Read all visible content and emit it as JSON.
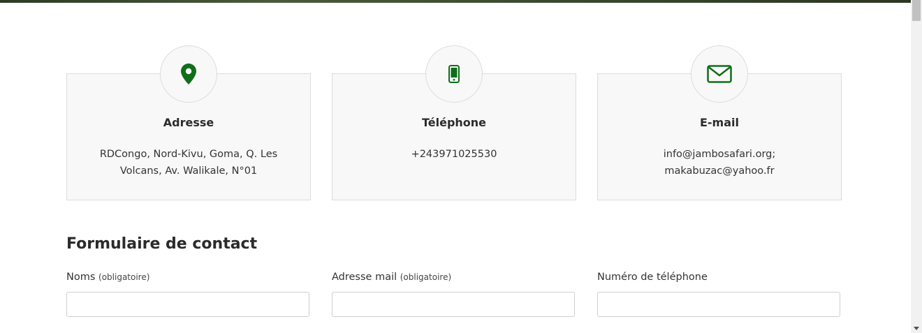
{
  "colors": {
    "accent": "#0f6e1a",
    "card_bg": "#f8f8f8",
    "border": "#dcdcdc"
  },
  "cards": [
    {
      "icon": "map-pin-icon",
      "title": "Adresse",
      "lines": [
        "RDCongo, Nord-Kivu, Goma, Q. Les",
        "Volcans, Av. Walikale, N°01"
      ]
    },
    {
      "icon": "phone-icon",
      "title": "Téléphone",
      "lines": [
        "+243971025530"
      ]
    },
    {
      "icon": "envelope-icon",
      "title": "E-mail",
      "lines": [
        "info@jambosafari.org;",
        "makabuzac@yahoo.fr"
      ]
    }
  ],
  "form": {
    "title": "Formulaire de contact",
    "fields": [
      {
        "label": "Noms",
        "note": "(obligatoire)",
        "value": "",
        "placeholder": ""
      },
      {
        "label": "Adresse mail",
        "note": "(obligatoire)",
        "value": "",
        "placeholder": ""
      },
      {
        "label": "Numéro de téléphone",
        "note": "",
        "value": "",
        "placeholder": ""
      }
    ]
  }
}
